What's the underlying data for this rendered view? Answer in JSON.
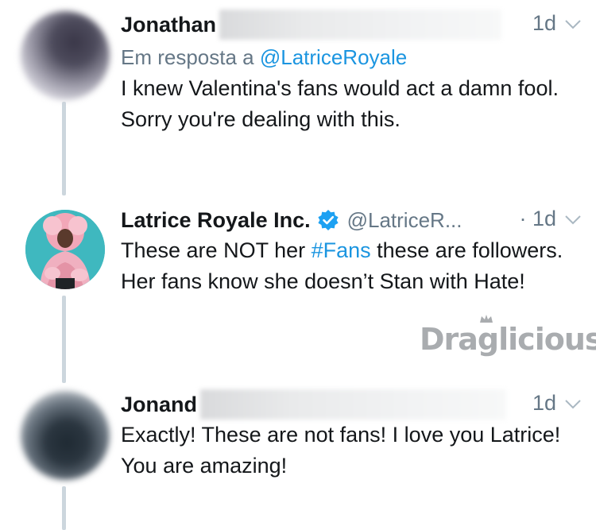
{
  "tweets": [
    {
      "name": "Jonathan",
      "time": "1d",
      "reply_prefix": "Em resposta a ",
      "reply_mention": "@LatriceRoyale",
      "text": "I knew Valentina's fans would act a damn fool. Sorry you're dealing with this."
    },
    {
      "name": "Latrice Royale Inc.",
      "handle": "@LatriceR...",
      "time": "· 1d",
      "text_before": "These are NOT her ",
      "hashtag": "#Fans",
      "text_after": " these are followers. Her fans know she doesn’t Stan with Hate!"
    },
    {
      "name": "Jonand",
      "time": "1d",
      "text": "Exactly!  These are not fans!  I love you Latrice!  You are amazing!"
    }
  ],
  "watermark": "Draglicious",
  "colors": {
    "link": "#1b95e0",
    "muted": "#657786",
    "thread_line": "#ccd6dd",
    "verified": "#1da1f2"
  },
  "icons": [
    "verified-badge-icon",
    "chevron-down-icon"
  ]
}
